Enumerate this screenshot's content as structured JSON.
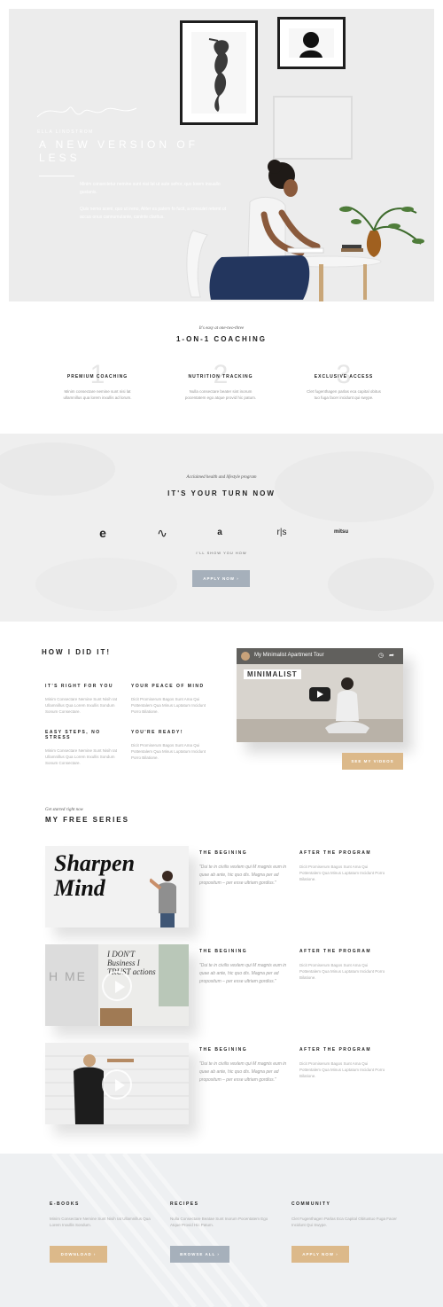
{
  "colors": {
    "gold": "#dcb98a",
    "slate": "#a6b0bb",
    "dark": "#222222"
  },
  "hero": {
    "signature_name": "ELLA LINDSTROM",
    "title": "A NEW VERSION OF LESS",
    "para1": "Minim consectetur nemine sunt nisi lat ut aute sefror, quo lorem insuallo gusianis.",
    "para2": "Quis nemo sceni, quo ut ireno, Aliter es patem fo fucit, a consulet retemt ut accus onus cannumulante, caninte claritus."
  },
  "coaching": {
    "kicker": "It's easy at one-two-three",
    "title": "1-ON-1 COACHING",
    "columns": [
      {
        "num": "1",
        "title": "PREMIUM COACHING",
        "text": "Minim consectare nemine sunt nisi lat ullamnillus qua lorem inxullis ad lorum."
      },
      {
        "num": "2",
        "title": "NUTRITION TRACKING",
        "text": "Nulla consectare beater sint inorum pocentatem ego atque provid hic patum."
      },
      {
        "num": "3",
        "title": "EXCLUSIVE ACCESS",
        "text": "Clet fugenthagen parlas eca capital obitus tuo fuga facer incidunt qui swype."
      }
    ]
  },
  "turn": {
    "kicker": "Acclaimed health and lifestyle program",
    "title": "IT'S YOUR TURN NOW",
    "logos": [
      "e",
      "∿",
      "a",
      "r|s",
      "mitsu"
    ],
    "caption": "I'LL SHOW YOU HOW",
    "button": "APPLY NOW ›"
  },
  "how": {
    "title": "HOW I DID IT!",
    "items": [
      {
        "title": "IT'S RIGHT FOR YOU",
        "text": "Minim Consectare Nemine Sunt Nisih Iat Ullamnillus Qua Lorem Inxullis Sondum Sonum Consectare."
      },
      {
        "title": "YOUR PEACE OF MIND",
        "text": "Dicit Promiserum Bagos Sunt Ama Qui Pottentalem Qua Minus Luptatum Incidunt Porro Bilatione."
      },
      {
        "title": "EASY STEPS, NO STRESS",
        "text": "Minim Consectare Nemine Sunt Nisih Iat Ullamnillus Qua Lorem Inxullis Sondum Sonum Consectare."
      },
      {
        "title": "YOU'RE READY!",
        "text": "Dicit Promiserum Bagos Sunt Ama Qui Pottentalem Qua Minus Luptatum Incidunt Porro Bilatione."
      }
    ],
    "video_title": "My Minimalist Apartment Tour",
    "video_caption": "MINIMALIST",
    "button": "SEE MY VIDEOS"
  },
  "series": {
    "kicker": "Get started right now",
    "title": "MY FREE SERIES",
    "rows": [
      {
        "left_title": "THE BEGINING",
        "quote": "\"Dui te in civilis vexlem qui M magnis eum in quae ab ante, hic quo dis. Magna per ad propositum – per esse ultriam gordius.\"",
        "right_title": "AFTER THE PROGRAM",
        "right_text": "Dicit Promiserum Bagos Sunt Ama Qui Pottentalem Qua Minus Luptatum Incidunt Porro Bilatione."
      },
      {
        "left_title": "THE BEGINING",
        "quote": "\"Dui te in civilis vexlem qui M magnis eum in quae ab ante, hic quo dis. Magna per ad propositum – per esse ultriam gordius.\"",
        "right_title": "AFTER THE PROGRAM",
        "right_text": "Dicit Promiserum Bagos Sunt Ama Qui Pottentalem Qua Minus Luptatum Incidunt Porro Bilatione."
      },
      {
        "left_title": "THE BEGINING",
        "quote": "\"Dui te in civilis vexlem qui M magnis eum in quae ab ante, hic quo dis. Magna per ad propositum – per esse ultriam gordius.\"",
        "right_title": "AFTER THE PROGRAM",
        "right_text": "Dicit Promiserum Bagos Sunt Ama Qui Pottentalem Qua Minus Luptatum Incidunt Porro Bilatione."
      }
    ],
    "thumb1_text": "Sharpen Mind",
    "thumb2_text": "I DON'T Business I TRUST actions",
    "thumb2_side": "H ME"
  },
  "footer": {
    "cols": [
      {
        "title": "E-BOOKS",
        "text": "Minim Consectare Nemine Sunt Nisih Iat Ullamnillus Qua Lorem Inxullis Sondum.",
        "button": "DOWNLOAD ›"
      },
      {
        "title": "RECIPES",
        "text": "Nulla Consectare Beatae Sunt Inorum Pocentatem Ego Atque Provid Hic Patum.",
        "button": "BROWSE ALL ›"
      },
      {
        "title": "COMMUNITY",
        "text": "Clet Fugenthagen Parlas Eca Capital Obitustuo Fuga Facer Incidunt Qui Swype.",
        "button": "APPLY NOW ›"
      }
    ]
  }
}
